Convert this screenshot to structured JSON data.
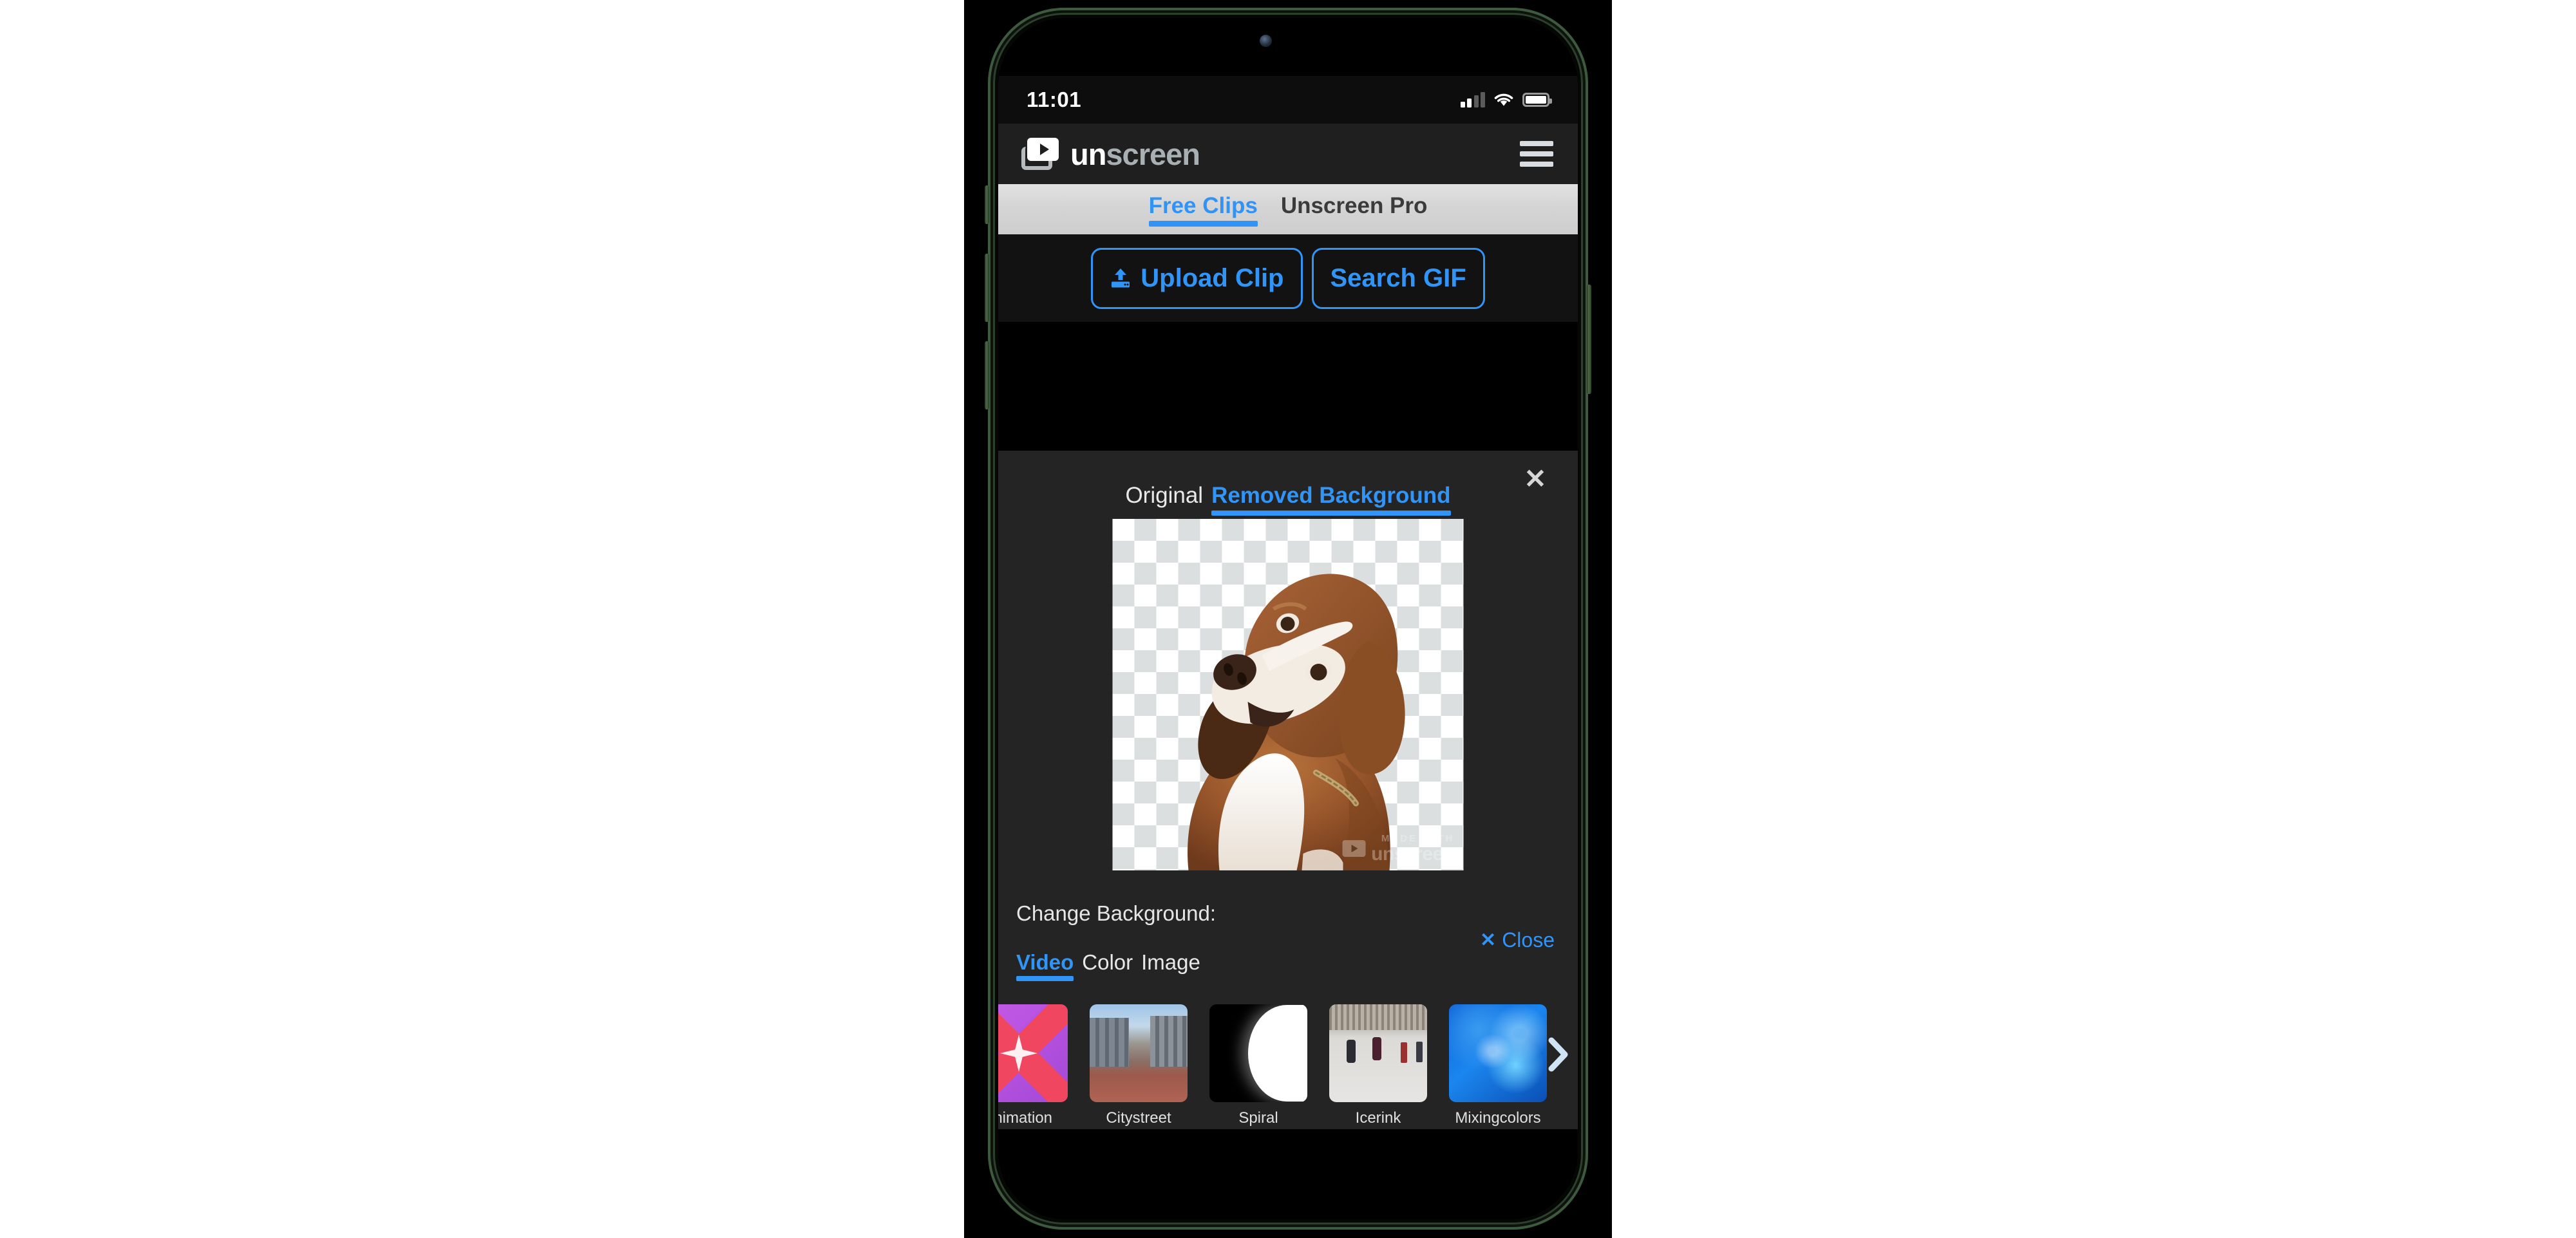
{
  "device": {
    "frame_color": "#3e5a3e",
    "screen_bg": "#000000"
  },
  "statusbar": {
    "time": "11:01",
    "cellular_icon": "cellular-signal-icon",
    "cellular_bars_filled": 2,
    "cellular_bars_total": 4,
    "wifi_icon": "wifi-icon",
    "battery_icon": "battery-full-icon",
    "battery_level": "100"
  },
  "appbar": {
    "logo_icon": "unscreen-video-logo-icon",
    "brand_part1": "un",
    "brand_part2": "screen",
    "menu_icon": "hamburger-menu-icon"
  },
  "top_tabs": {
    "accent": "#2f93f7",
    "items": [
      {
        "label": "Free Clips",
        "active": true
      },
      {
        "label": "Unscreen Pro",
        "active": false
      }
    ]
  },
  "actions": {
    "upload_icon": "upload-icon",
    "upload_label": "Upload Clip",
    "search_label": "Search GIF",
    "accent": "#3194f7"
  },
  "panel": {
    "close_icon": "close-icon",
    "result_tabs": [
      {
        "label": "Original",
        "active": false
      },
      {
        "label": "Removed Background",
        "active": true
      }
    ],
    "preview": {
      "subject": "dog-tilting-head",
      "transparency": "checkerboard",
      "watermark_made": "MADE WITH",
      "watermark_brand": "unscreen",
      "watermark_icon": "unscreen-video-logo-icon"
    },
    "change_background_label": "Change Background:",
    "close_link_icon": "close-x-icon",
    "close_link_label": "Close",
    "bg_tabs": [
      {
        "label": "Video",
        "active": true
      },
      {
        "label": "Color",
        "active": false
      },
      {
        "label": "Image",
        "active": false
      }
    ],
    "next_arrow_icon": "chevron-right-icon",
    "thumbnails": [
      {
        "label": "animation",
        "art": "art-animation"
      },
      {
        "label": "Citystreet",
        "art": "art-city"
      },
      {
        "label": "Spiral",
        "art": "art-spiral"
      },
      {
        "label": "Icerink",
        "art": "art-ice"
      },
      {
        "label": "Mixingcolors",
        "art": "art-mix"
      }
    ]
  }
}
